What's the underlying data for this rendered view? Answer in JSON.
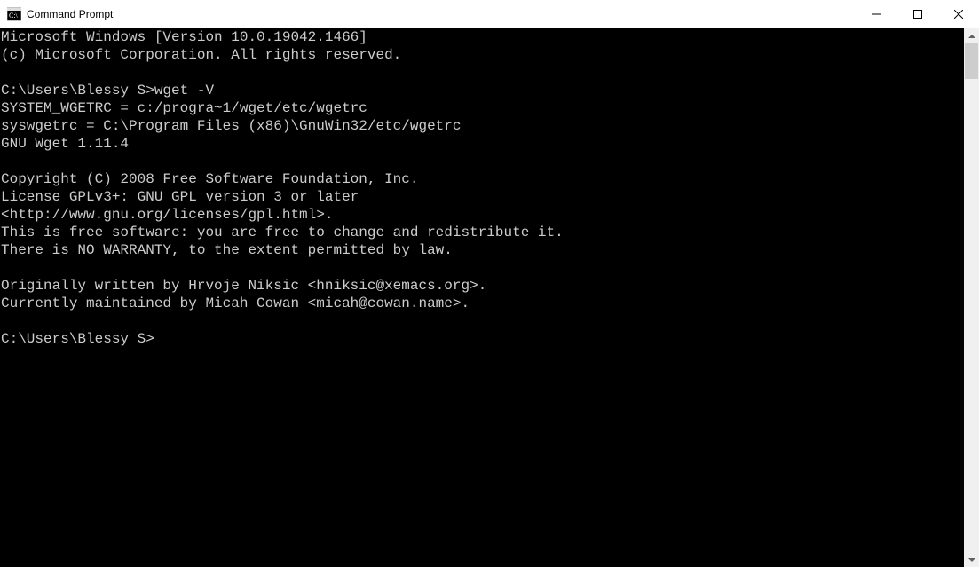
{
  "window": {
    "title": "Command Prompt"
  },
  "terminal": {
    "lines": [
      "Microsoft Windows [Version 10.0.19042.1466]",
      "(c) Microsoft Corporation. All rights reserved.",
      "",
      "C:\\Users\\Blessy S>wget -V",
      "SYSTEM_WGETRC = c:/progra~1/wget/etc/wgetrc",
      "syswgetrc = C:\\Program Files (x86)\\GnuWin32/etc/wgetrc",
      "GNU Wget 1.11.4",
      "",
      "Copyright (C) 2008 Free Software Foundation, Inc.",
      "License GPLv3+: GNU GPL version 3 or later",
      "<http://www.gnu.org/licenses/gpl.html>.",
      "This is free software: you are free to change and redistribute it.",
      "There is NO WARRANTY, to the extent permitted by law.",
      "",
      "Originally written by Hrvoje Niksic <hniksic@xemacs.org>.",
      "Currently maintained by Micah Cowan <micah@cowan.name>.",
      "",
      "C:\\Users\\Blessy S>"
    ]
  }
}
